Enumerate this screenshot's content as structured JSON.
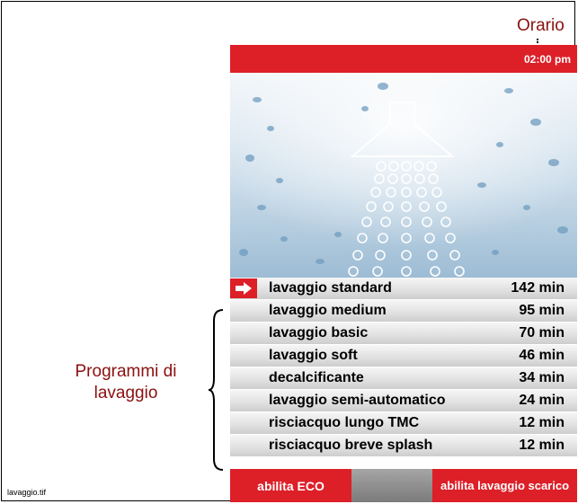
{
  "annotations": {
    "orario": "Orario",
    "programmi": "Programmi di lavaggio",
    "file_caption": "lavaggio.tif"
  },
  "header": {
    "time": "02:00 pm"
  },
  "programs": [
    {
      "name": "lavaggio standard",
      "duration": "142 min",
      "selected": true
    },
    {
      "name": "lavaggio medium",
      "duration": "95 min"
    },
    {
      "name": "lavaggio basic",
      "duration": "70 min"
    },
    {
      "name": "lavaggio soft",
      "duration": "46 min"
    },
    {
      "name": "decalcificante",
      "duration": "34 min"
    },
    {
      "name": "lavaggio semi-automatico",
      "duration": "24 min"
    },
    {
      "name": "risciacquo lungo TMC",
      "duration": "12 min"
    },
    {
      "name": "risciacquo breve splash",
      "duration": "12 min"
    }
  ],
  "footer": {
    "eco_label": "abilita ECO",
    "scarico_label": "abilita lavaggio scarico"
  },
  "colors": {
    "brand_red": "#dd1f28",
    "annotation_red": "#8b1010",
    "water_blue": "#7fa8c8"
  },
  "icons": {
    "hero": "shower-head-icon",
    "selection": "arrow-right-icon"
  }
}
